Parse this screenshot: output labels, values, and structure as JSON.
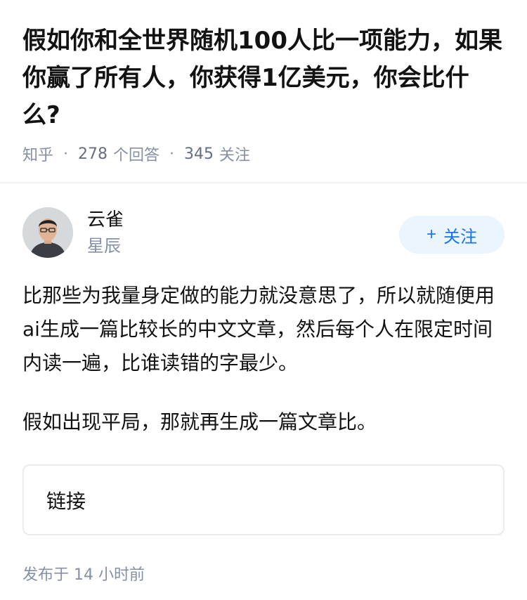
{
  "question": {
    "title": "假如你和全世界随机100人比一项能力，如果你赢了所有人，你获得1亿美元，你会比什么?",
    "source": "知乎",
    "answer_count": "278",
    "answer_count_label": "个回答",
    "follow_count": "345",
    "follow_count_label": "关注"
  },
  "answer": {
    "author_name": "云雀",
    "author_badge": "星辰",
    "follow_button_label": "关注",
    "paragraphs": [
      "比那些为我量身定做的能力就没意思了，所以就随便用ai生成一篇比较长的中文文章，然后每个人在限定时间内读一遍，比谁读错的字最少。",
      "假如出现平局，那就再生成一篇文章比。"
    ],
    "link_card_label": "链接",
    "publish_time": "发布于  14 小时前"
  },
  "colors": {
    "accent": "#1772f6",
    "follow_bg": "#ebf5fd",
    "muted_text": "#8590a6"
  },
  "icons": {
    "follow": "plus-icon"
  }
}
